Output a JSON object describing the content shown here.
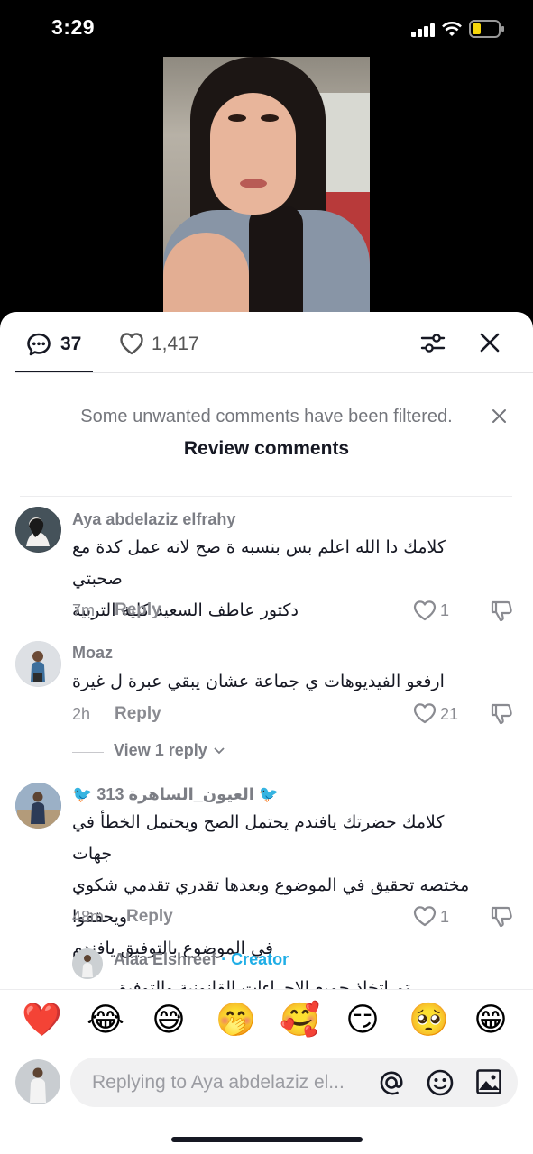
{
  "status_bar": {
    "time": "3:29"
  },
  "tabs": {
    "comments_count": "37",
    "likes_count": "1,417"
  },
  "filter_notice": {
    "text": "Some unwanted comments have been filtered.",
    "action": "Review comments"
  },
  "comments": [
    {
      "username": "Aya abdelaziz elfrahy",
      "text_line1": "كلامك دا الله اعلم بس بنسبه ة صح لانه عمل كدة مع صحبتي",
      "text_line2": "دكتور عاطف السعيد كلية التربية",
      "time": "7m",
      "reply_label": "Reply",
      "likes": "1"
    },
    {
      "username": "Moaz",
      "text_line1": "ارفعو الفيديوهات ي جماعة عشان يبقي عبرة ل غيرة",
      "time": "2h",
      "reply_label": "Reply",
      "likes": "21",
      "view_replies": "View 1 reply"
    },
    {
      "username": "🐦 العيون_الساهرة 313 🐦",
      "text_line1": "كلامك حضرتك يافندم يحتمل الصح ويحتمل الخطأ في جهات",
      "text_line2": "مختصه تحقيق في الموضوع وبعدها تقدري تقدمي شكوي ويحققوا",
      "text_line3": "في الموضوع بالتوفيق يافندم",
      "time": "48m",
      "reply_label": "Reply",
      "likes": "1"
    }
  ],
  "reply_preview": {
    "username": "Alaa Elshreef",
    "separator": "·",
    "badge": "Creator",
    "text": "تم اتخاذ جميع الاجراءات القانونية والتوفيق"
  },
  "emoji_bar": [
    "❤️",
    "😂",
    "😅",
    "🤭",
    "🥰",
    "😏",
    "🥺",
    "😁"
  ],
  "input": {
    "placeholder": "Replying to Aya abdelaziz el..."
  },
  "icons": [
    "comment-icon",
    "heart-icon",
    "filter-icon",
    "close-icon",
    "like-icon",
    "dislike-icon",
    "at-icon",
    "emoji-icon",
    "image-icon"
  ],
  "colors": {
    "creator": "#20aee6",
    "text": "#161823",
    "muted": "#8a8b91"
  }
}
